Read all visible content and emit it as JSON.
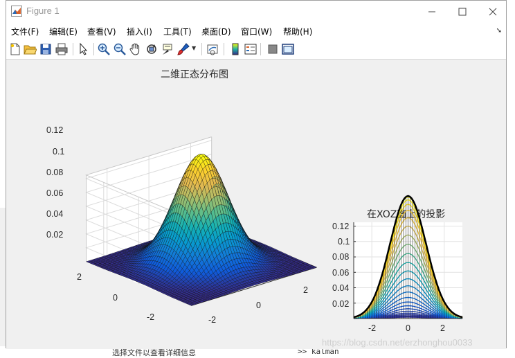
{
  "window": {
    "title": "Figure 1"
  },
  "menu": [
    {
      "label": "文件(F)"
    },
    {
      "label": "编辑(E)"
    },
    {
      "label": "查看(V)"
    },
    {
      "label": "插入(I)"
    },
    {
      "label": "工具(T)"
    },
    {
      "label": "桌面(D)"
    },
    {
      "label": "窗口(W)"
    },
    {
      "label": "帮助(H)"
    }
  ],
  "toolbar_icons": [
    "new-figure",
    "open-file",
    "save",
    "print",
    "edit-plot",
    "zoom-in",
    "zoom-out",
    "pan",
    "rotate-3d",
    "data-cursor",
    "brush",
    "link-plot",
    "colorbar",
    "legend",
    "hide-plot-tools",
    "show-plot-tools"
  ],
  "plot1": {
    "title": "二维正态分布图",
    "zticks": [
      "0.12",
      "0.1",
      "0.08",
      "0.06",
      "0.04",
      "0.02"
    ],
    "yticks": [
      "2",
      "0",
      "-2"
    ],
    "xticks": [
      "-2",
      "0",
      "2"
    ]
  },
  "plot2": {
    "title": "在XOZ面上的投影",
    "yticks": [
      "0.12",
      "0.1",
      "0.08",
      "0.06",
      "0.04",
      "0.02"
    ],
    "xticks": [
      "-2",
      "0",
      "2"
    ]
  },
  "chart_data": [
    {
      "type": "surface",
      "title": "二维正态分布图",
      "function": "bivariate standard normal pdf",
      "x_range": [
        -3,
        3
      ],
      "y_range": [
        -3,
        3
      ],
      "zlim": [
        0,
        0.12
      ],
      "peak": 0.159,
      "colormap": "parula"
    },
    {
      "type": "line",
      "title": "在XOZ面上的投影",
      "xlim": [
        -3,
        3
      ],
      "ylim": [
        0,
        0.12
      ],
      "xticks": [
        -2,
        0,
        2
      ],
      "yticks": [
        0.02,
        0.04,
        0.06,
        0.08,
        0.1,
        0.12
      ]
    }
  ],
  "watermark": "https://blog.csdn.net/erzhonghou0033",
  "background": {
    "bottom_label": "选择文件以查看详细信息",
    "command": ">> kalman"
  }
}
